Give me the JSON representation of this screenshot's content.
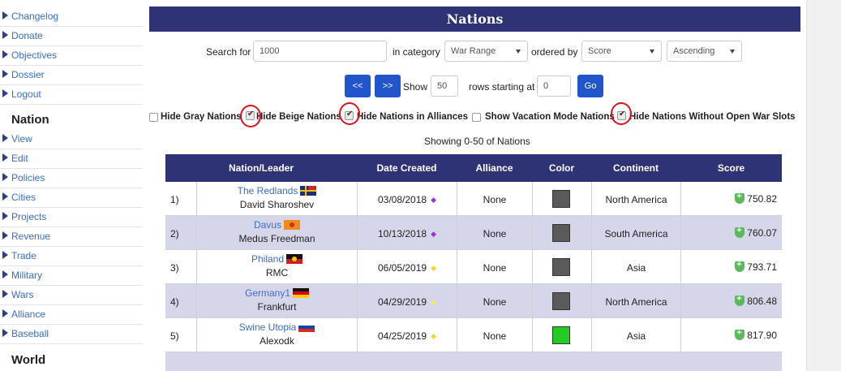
{
  "sidebar": {
    "items_top": [
      "Changelog",
      "Donate",
      "Objectives",
      "Dossier",
      "Logout"
    ],
    "nation_heading": "Nation",
    "items_nation": [
      "View",
      "Edit",
      "Policies",
      "Cities",
      "Projects",
      "Revenue",
      "Trade",
      "Military",
      "Wars",
      "Alliance",
      "Baseball"
    ],
    "world_heading": "World"
  },
  "header": {
    "title": "Nations"
  },
  "search": {
    "label": "Search for",
    "value": "1000",
    "category_label": "in category",
    "category": "War Range",
    "ordered_label": "ordered by",
    "order_by": "Score",
    "direction": "Ascending"
  },
  "paging": {
    "prev_label": "<<",
    "next_label": ">>",
    "show_label": "Show",
    "rows": "50",
    "starting_label": "rows starting at",
    "start": "0",
    "go_label": "Go"
  },
  "options": [
    {
      "label": "Hide Gray Nations",
      "checked": false
    },
    {
      "label": "Hide Beige Nations",
      "checked": true
    },
    {
      "label": "Hide Nations in Alliances",
      "checked": true
    },
    {
      "label": "Show Vacation Mode Nations",
      "checked": false
    },
    {
      "label": "Hide Nations Without Open War Slots",
      "checked": true
    }
  ],
  "showing": "Showing 0-50 of Nations",
  "table": {
    "headers": [
      "Nation/Leader",
      "Date Created",
      "Alliance",
      "Color",
      "Continent",
      "Score"
    ],
    "rows": [
      {
        "num": "1)",
        "nation": "The Redlands",
        "leader": "David Sharoshev",
        "date": "03/08/2018",
        "marker_color": "#9b30d9",
        "alliance": "None",
        "color": "#5a5a5a",
        "continent": "North America",
        "score": "750.82"
      },
      {
        "num": "2)",
        "nation": "Davus",
        "leader": "Medus Freedman",
        "date": "10/13/2018",
        "marker_color": "#9b30d9",
        "alliance": "None",
        "color": "#5a5a5a",
        "continent": "South America",
        "score": "760.07"
      },
      {
        "num": "3)",
        "nation": "Philand",
        "leader": "RMC",
        "date": "06/05/2019",
        "marker_color": "#f2d43a",
        "alliance": "None",
        "color": "#5a5a5a",
        "continent": "Asia",
        "score": "793.71"
      },
      {
        "num": "4)",
        "nation": "Germany1",
        "leader": "Frankfurt",
        "date": "04/29/2019",
        "marker_color": "#f2e86a",
        "alliance": "None",
        "color": "#5a5a5a",
        "continent": "North America",
        "score": "806.48"
      },
      {
        "num": "5)",
        "nation": "Swine Utopia",
        "leader": "Alexodk",
        "date": "04/25/2019",
        "marker_color": "#f2d43a",
        "alliance": "None",
        "color": "#22cc22",
        "continent": "Asia",
        "score": "817.90"
      }
    ]
  },
  "colors": {
    "header_bg": "#2e3376",
    "button_bg": "#2255cc",
    "alt_row": "#d6d6ea",
    "annotation_red": "#e0101a"
  }
}
